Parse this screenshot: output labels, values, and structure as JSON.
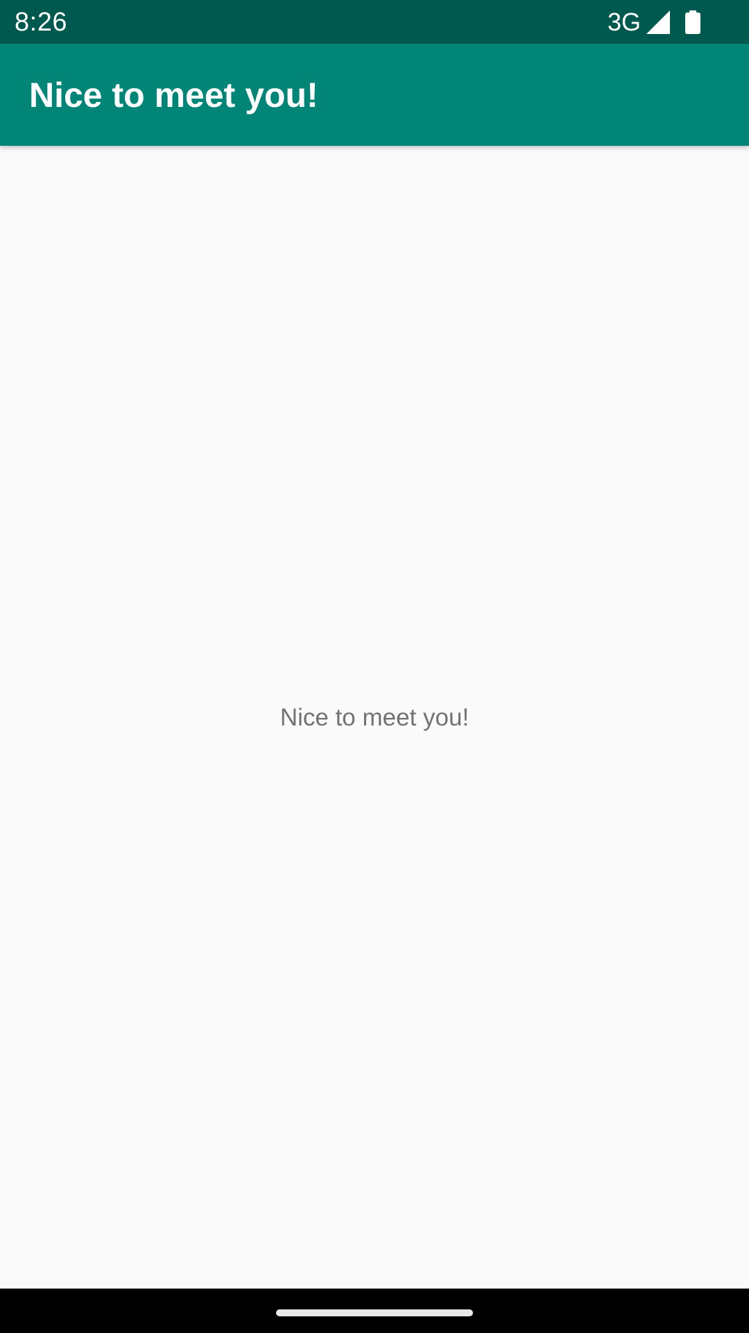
{
  "status_bar": {
    "time": "8:26",
    "network": "3G",
    "icons": [
      "signal-icon",
      "battery-icon"
    ]
  },
  "app_bar": {
    "title": "Nice to meet you!"
  },
  "main": {
    "message": "Nice to meet you!"
  },
  "colors": {
    "status_bar": "#00594f",
    "app_bar": "#008577",
    "background": "#fafafa",
    "message_text": "#737373",
    "nav_bar": "#000000"
  }
}
